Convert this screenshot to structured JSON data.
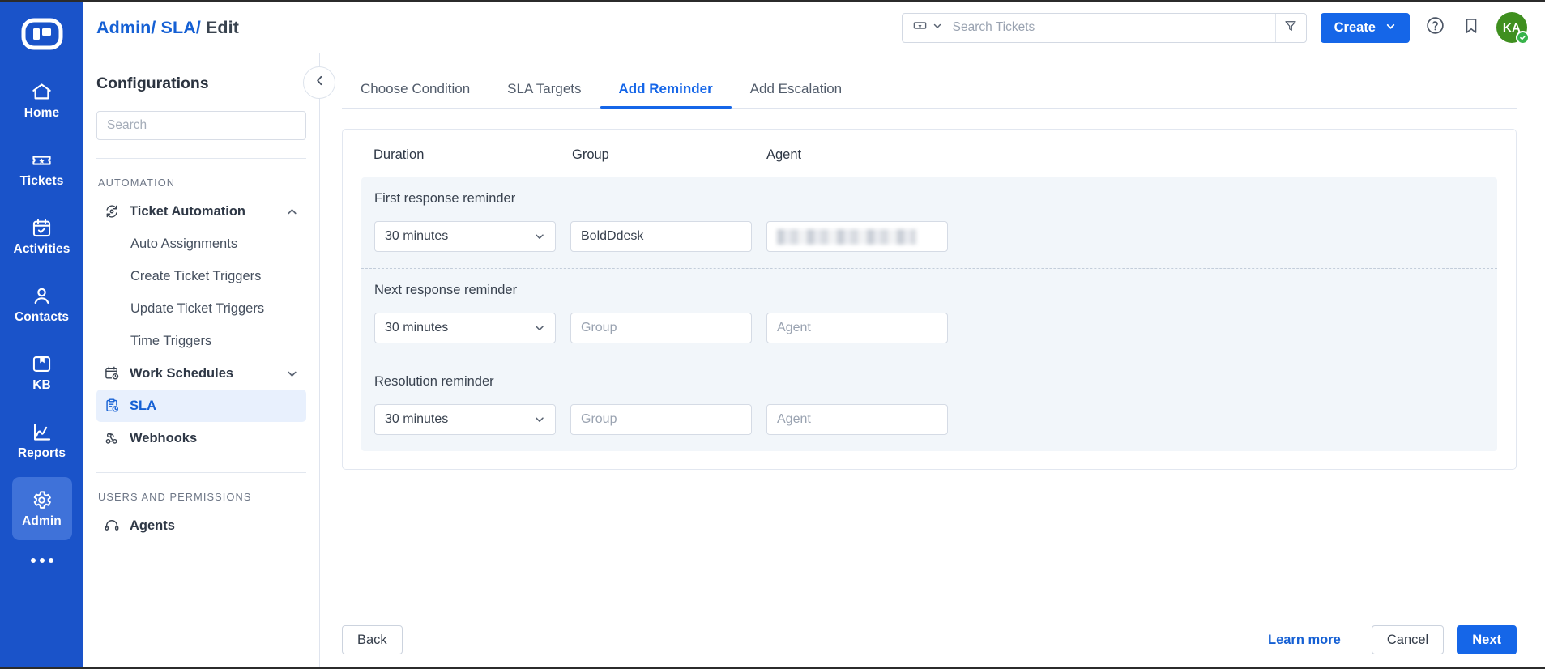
{
  "rail": {
    "logo_icon": "boldesk-logo-icon",
    "items": [
      {
        "label": "Home",
        "icon": "home-icon",
        "active": false
      },
      {
        "label": "Tickets",
        "icon": "ticket-icon",
        "active": false
      },
      {
        "label": "Activities",
        "icon": "calendar-check-icon",
        "active": false
      },
      {
        "label": "Contacts",
        "icon": "person-icon",
        "active": false
      },
      {
        "label": "KB",
        "icon": "book-icon",
        "active": false
      },
      {
        "label": "Reports",
        "icon": "chart-line-icon",
        "active": false
      },
      {
        "label": "Admin",
        "icon": "gear-icon",
        "active": true
      }
    ],
    "more_label": "more-options"
  },
  "header": {
    "breadcrumb": {
      "admin": "Admin/",
      "sla": " SLA/",
      "current": " Edit"
    },
    "search": {
      "placeholder": "Search Tickets",
      "value": "",
      "type_icon": "ticket-icon",
      "filter_icon": "filter-icon"
    },
    "create_label": "Create",
    "help_icon": "help-circle-icon",
    "bookmark_icon": "bookmark-icon",
    "avatar": {
      "initials": "KA",
      "status": "online"
    }
  },
  "sidebar": {
    "title": "Configurations",
    "search_placeholder": "Search",
    "search_value": "",
    "collapse_icon": "chevron-left-icon",
    "groups": [
      {
        "label": "AUTOMATION",
        "items": [
          {
            "label": "Ticket Automation",
            "icon": "automation-icon",
            "type": "parent",
            "expanded": true,
            "active": false
          },
          {
            "label": "Auto Assignments",
            "type": "child",
            "active": false
          },
          {
            "label": "Create Ticket Triggers",
            "type": "child",
            "active": false
          },
          {
            "label": "Update Ticket Triggers",
            "type": "child",
            "active": false
          },
          {
            "label": "Time Triggers",
            "type": "child",
            "active": false
          },
          {
            "label": "Work Schedules",
            "icon": "calendar-clock-icon",
            "type": "parent",
            "expanded": false,
            "active": false
          },
          {
            "label": "SLA",
            "icon": "clipboard-clock-icon",
            "type": "leaf",
            "active": true
          },
          {
            "label": "Webhooks",
            "icon": "webhook-icon",
            "type": "leaf",
            "active": false
          }
        ]
      },
      {
        "label": "USERS AND PERMISSIONS",
        "items": [
          {
            "label": "Agents",
            "icon": "headset-icon",
            "type": "leaf",
            "active": false
          }
        ]
      }
    ]
  },
  "main": {
    "tabs": [
      {
        "label": "Choose Condition",
        "active": false
      },
      {
        "label": "SLA Targets",
        "active": false
      },
      {
        "label": "Add Reminder",
        "active": true
      },
      {
        "label": "Add Escalation",
        "active": false
      }
    ],
    "columns": {
      "duration": "Duration",
      "group": "Group",
      "agent": "Agent"
    },
    "reminders": [
      {
        "label": "First response reminder",
        "duration": "30 minutes",
        "group_value": "BoldDdesk",
        "group_placeholder": "Group",
        "agent_value": "",
        "agent_placeholder": "Agent",
        "agent_redacted": "true"
      },
      {
        "label": "Next response reminder",
        "duration": "30 minutes",
        "group_value": "",
        "group_placeholder": "Group",
        "agent_value": "",
        "agent_placeholder": "Agent",
        "agent_redacted": "false"
      },
      {
        "label": "Resolution reminder",
        "duration": "30 minutes",
        "group_value": "",
        "group_placeholder": "Group",
        "agent_value": "",
        "agent_placeholder": "Agent",
        "agent_redacted": "false"
      }
    ],
    "footer": {
      "back": "Back",
      "learn_more": "Learn more",
      "cancel": "Cancel",
      "next": "Next"
    }
  },
  "colors": {
    "rail_blue": "#1a53c9",
    "accent_blue": "#1566e8",
    "link_blue": "#1560d4",
    "panel_bg": "#f2f6fa",
    "avatar_green": "#3f8f1f",
    "status_green": "#37b34a"
  }
}
